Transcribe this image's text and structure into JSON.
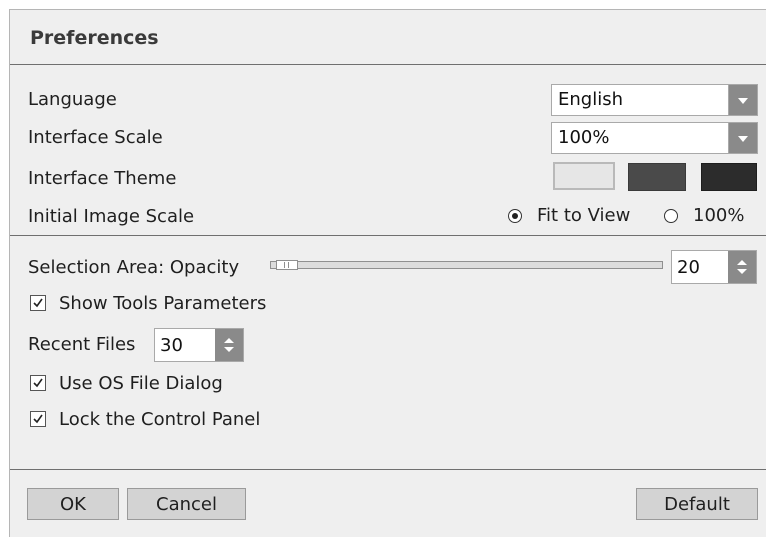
{
  "dialog": {
    "title": "Preferences",
    "language": {
      "label": "Language",
      "value": "English"
    },
    "interface_scale": {
      "label": "Interface Scale",
      "value": "100%"
    },
    "interface_theme": {
      "label": "Interface Theme",
      "themes": [
        {
          "name": "light",
          "color": "#e6e6e6",
          "selected": true
        },
        {
          "name": "medium",
          "color": "#4a4a4a",
          "selected": false
        },
        {
          "name": "dark",
          "color": "#2c2c2c",
          "selected": false
        }
      ]
    },
    "initial_image_scale": {
      "label": "Initial Image Scale",
      "options": [
        "Fit to View",
        "100%"
      ],
      "selected": "Fit to View"
    },
    "selection_opacity": {
      "label": "Selection Area: Opacity",
      "value": "20",
      "level_percent": 20
    },
    "show_tools_parameters": {
      "label": "Show Tools Parameters",
      "checked": true
    },
    "recent_files": {
      "label": "Recent Files",
      "value": "30"
    },
    "use_os_file_dialog": {
      "label": "Use OS File Dialog",
      "checked": true
    },
    "lock_control_panel": {
      "label": "Lock the Control Panel",
      "checked": true
    },
    "buttons": {
      "ok": "OK",
      "cancel": "Cancel",
      "default": "Default"
    }
  },
  "icons": {
    "dropdown": "chevron-down-icon",
    "spinner": "up-down-arrows-icon",
    "checkmark": "check-icon",
    "radio": "radio-dot-icon"
  }
}
